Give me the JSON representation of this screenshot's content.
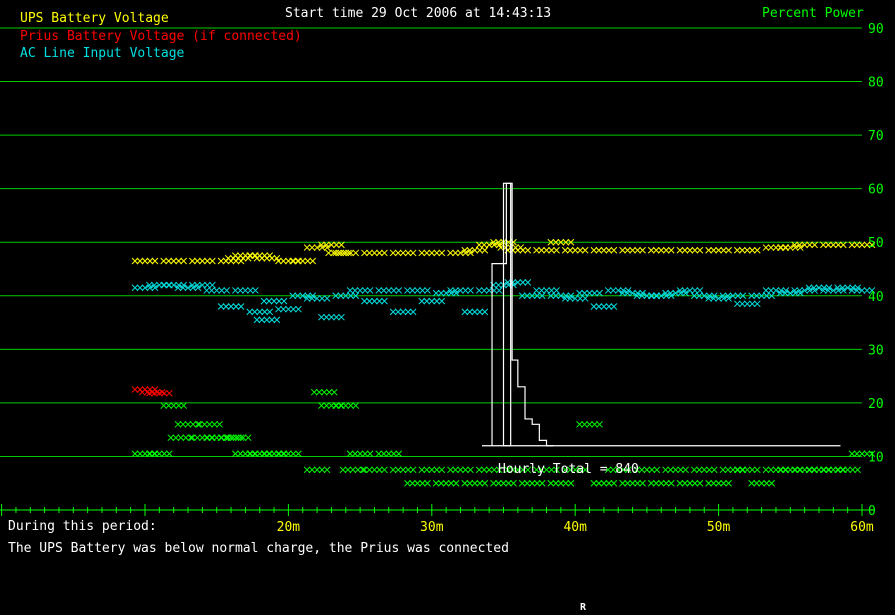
{
  "header": {
    "start_time": "Start time 29 Oct 2006 at 14:43:13",
    "right_title": "Percent Power"
  },
  "legend": [
    {
      "label": "UPS Battery Voltage",
      "color": "#ffff00"
    },
    {
      "label": "Prius Battery Voltage (if connected)",
      "color": "#ff0000"
    },
    {
      "label": "AC Line Input Voltage",
      "color": "#00e0e0"
    }
  ],
  "footer": {
    "period_label": "During this period:",
    "summary": "The UPS Battery was below normal charge, the Prius was connected",
    "marker": "R"
  },
  "colors": {
    "background": "#000000",
    "grid": "#00cc00",
    "axis_text": "#00ff00",
    "x_label": "#ffff00",
    "histogram": "#ffffff",
    "green_series": "#00ff00"
  },
  "chart_data": {
    "type": "scatter",
    "y_axis": {
      "side": "right",
      "range": [
        0,
        90
      ],
      "ticks": [
        0,
        10,
        20,
        30,
        40,
        50,
        60,
        70,
        80,
        90
      ]
    },
    "x_axis": {
      "range": [
        10,
        60
      ],
      "unit": "minutes",
      "tick_labels": [
        {
          "x": 20,
          "label": "20m"
        },
        {
          "x": 30,
          "label": "30m"
        },
        {
          "x": 40,
          "label": "40m"
        },
        {
          "x": 50,
          "label": "50m"
        },
        {
          "x": 60,
          "label": "60m"
        }
      ]
    },
    "grid": true,
    "legend_placement": "top-left",
    "series": [
      {
        "name": "UPS Battery Voltage",
        "color": "#ffff00",
        "points": [
          [
            10,
            46.5
          ],
          [
            12,
            46.5
          ],
          [
            14,
            46.5
          ],
          [
            16,
            46.5
          ],
          [
            16.5,
            47
          ],
          [
            17,
            47.5
          ],
          [
            18,
            47.5
          ],
          [
            18.5,
            47
          ],
          [
            20,
            46.5
          ],
          [
            21,
            46.5
          ],
          [
            22,
            49
          ],
          [
            23,
            49.5
          ],
          [
            23.5,
            48
          ],
          [
            24,
            48
          ],
          [
            26,
            48
          ],
          [
            28,
            48
          ],
          [
            30,
            48
          ],
          [
            32,
            48
          ],
          [
            33,
            48.5
          ],
          [
            34,
            49.5
          ],
          [
            35,
            50
          ],
          [
            35.5,
            49
          ],
          [
            36,
            48.5
          ],
          [
            38,
            48.5
          ],
          [
            39,
            50
          ],
          [
            40,
            48.5
          ],
          [
            42,
            48.5
          ],
          [
            44,
            48.5
          ],
          [
            46,
            48.5
          ],
          [
            48,
            48.5
          ],
          [
            50,
            48.5
          ],
          [
            52,
            48.5
          ],
          [
            54,
            49
          ],
          [
            55,
            49
          ],
          [
            56,
            49.5
          ],
          [
            58,
            49.5
          ],
          [
            60,
            49.5
          ]
        ]
      },
      {
        "name": "Prius Battery Voltage (if connected)",
        "color": "#ff0000",
        "points": [
          [
            10,
            22.5
          ],
          [
            10.5,
            22
          ],
          [
            11,
            21.8
          ]
        ]
      },
      {
        "name": "AC Line Input Voltage",
        "color": "#00e0e0",
        "points": [
          [
            10,
            41.5
          ],
          [
            11,
            42
          ],
          [
            12,
            42
          ],
          [
            13,
            41.5
          ],
          [
            14,
            42
          ],
          [
            15,
            41
          ],
          [
            16,
            38
          ],
          [
            17,
            41
          ],
          [
            18,
            37
          ],
          [
            18.5,
            35.5
          ],
          [
            19,
            39
          ],
          [
            20,
            37.5
          ],
          [
            21,
            40
          ],
          [
            22,
            39.5
          ],
          [
            23,
            36
          ],
          [
            24,
            40
          ],
          [
            25,
            41
          ],
          [
            26,
            39
          ],
          [
            27,
            41
          ],
          [
            28,
            37
          ],
          [
            29,
            41
          ],
          [
            30,
            39
          ],
          [
            31,
            40.5
          ],
          [
            32,
            41
          ],
          [
            33,
            37
          ],
          [
            34,
            41
          ],
          [
            35,
            42
          ],
          [
            36,
            42.5
          ],
          [
            37,
            40
          ],
          [
            38,
            41
          ],
          [
            39,
            40
          ],
          [
            40,
            39.5
          ],
          [
            41,
            40.5
          ],
          [
            42,
            38
          ],
          [
            43,
            41
          ],
          [
            44,
            40.5
          ],
          [
            45,
            40
          ],
          [
            46,
            40
          ],
          [
            47,
            40.5
          ],
          [
            48,
            41
          ],
          [
            49,
            40
          ],
          [
            50,
            39.5
          ],
          [
            51,
            40
          ],
          [
            52,
            38.5
          ],
          [
            53,
            40
          ],
          [
            54,
            41
          ],
          [
            55,
            40.5
          ],
          [
            56,
            41
          ],
          [
            57,
            41.5
          ],
          [
            58,
            41
          ],
          [
            59,
            41.5
          ],
          [
            60,
            41
          ]
        ]
      },
      {
        "name": "",
        "color": "#00ff00",
        "points": [
          [
            10,
            10.5
          ],
          [
            11,
            10.5
          ],
          [
            12,
            19.5
          ],
          [
            12.5,
            13.5
          ],
          [
            13,
            16
          ],
          [
            14,
            13.5
          ],
          [
            14.5,
            16
          ],
          [
            15,
            13.5
          ],
          [
            16,
            13.5
          ],
          [
            16.5,
            13.5
          ],
          [
            17,
            10.5
          ],
          [
            18,
            10.5
          ],
          [
            19,
            10.5
          ],
          [
            20,
            10.5
          ],
          [
            22,
            7.5
          ],
          [
            22.5,
            22
          ],
          [
            23,
            19.5
          ],
          [
            24,
            19.5
          ],
          [
            24.5,
            7.5
          ],
          [
            25,
            10.5
          ],
          [
            26,
            7.5
          ],
          [
            27,
            10.5
          ],
          [
            28,
            7.5
          ],
          [
            29,
            5
          ],
          [
            30,
            7.5
          ],
          [
            31,
            5
          ],
          [
            32,
            7.5
          ],
          [
            33,
            5
          ],
          [
            34,
            7.5
          ],
          [
            35,
            5
          ],
          [
            36,
            7.5
          ],
          [
            37,
            5
          ],
          [
            38,
            7.5
          ],
          [
            39,
            5
          ],
          [
            40,
            7.5
          ],
          [
            41,
            16
          ],
          [
            42,
            5
          ],
          [
            43,
            7.5
          ],
          [
            44,
            5
          ],
          [
            45,
            7.5
          ],
          [
            46,
            5
          ],
          [
            47,
            7.5
          ],
          [
            48,
            5
          ],
          [
            49,
            7.5
          ],
          [
            50,
            5
          ],
          [
            51,
            7.5
          ],
          [
            52,
            7.5
          ],
          [
            53,
            5
          ],
          [
            54,
            7.5
          ],
          [
            55,
            7.5
          ],
          [
            56,
            7.5
          ],
          [
            57,
            7.5
          ],
          [
            58,
            7.5
          ],
          [
            59,
            7.5
          ],
          [
            60,
            10.5
          ]
        ]
      }
    ],
    "histogram": {
      "label": "Hourly Total = 840",
      "baseline": 12,
      "steps": [
        [
          35,
          46
        ],
        [
          35.2,
          61
        ],
        [
          35.6,
          28
        ],
        [
          36,
          23
        ],
        [
          36.5,
          17
        ],
        [
          37,
          16
        ],
        [
          37.5,
          13
        ],
        [
          38,
          12
        ]
      ]
    }
  }
}
